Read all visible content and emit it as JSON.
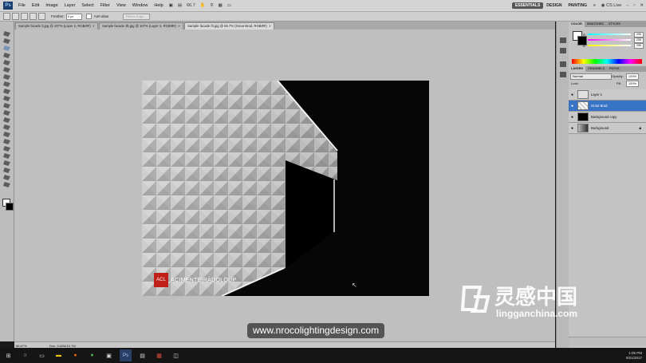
{
  "menubar": {
    "logo": "Ps",
    "items": [
      "File",
      "Edit",
      "Image",
      "Layer",
      "Select",
      "Filter",
      "View",
      "Window",
      "Help"
    ],
    "zoom_value": "66.7",
    "workspaces": [
      "ESSENTIALS",
      "DESIGN",
      "PAINTING"
    ],
    "more": "»",
    "cs_live": "CS Live"
  },
  "options": {
    "feather_label": "Feather:",
    "feather_value": "0 px",
    "antialias_label": "Anti-alias",
    "refine_label": "Refine Edge..."
  },
  "tabs": [
    {
      "label": "Sample facade 3.jpg @ 107% (Layer 2, RGB/8#)"
    },
    {
      "label": "Sample facade 3b.jpg @ 107% (Layer 2, RGB/8#)"
    },
    {
      "label": "Sample facade f3.jpg @ 66.7% (Grout Brod, RGB/8#)"
    }
  ],
  "document": {
    "logo_mark": "ACL",
    "logo_text": "ACIMENTEIRADOLOUP"
  },
  "status": {
    "zoom": "66.67%",
    "doc": "Doc: 3.62M/10.7M"
  },
  "color_panel": {
    "tabs": [
      "COLOR",
      "SWATCHES",
      "STYLES"
    ],
    "channels": [
      {
        "name": "R",
        "value": "255"
      },
      {
        "name": "G",
        "value": "255"
      },
      {
        "name": "B",
        "value": "255"
      }
    ]
  },
  "layers_panel": {
    "tabs": [
      "LAYERS",
      "CHANNELS",
      "PATHS"
    ],
    "blend_mode": "Normal",
    "opacity_label": "Opacity:",
    "opacity_value": "100%",
    "lock_label": "Lock:",
    "fill_label": "Fill:",
    "fill_value": "100%",
    "layers": [
      {
        "name": "Layer 1"
      },
      {
        "name": "Grout Brod"
      },
      {
        "name": "Background copy"
      },
      {
        "name": "Background"
      }
    ]
  },
  "taskbar": {
    "time": "1:05 PM",
    "date": "9/21/2017"
  },
  "watermark": {
    "url": "www.nrocolightingdesign.com",
    "brand_cn": "灵感中国",
    "brand_en": "lingganchina.com"
  }
}
